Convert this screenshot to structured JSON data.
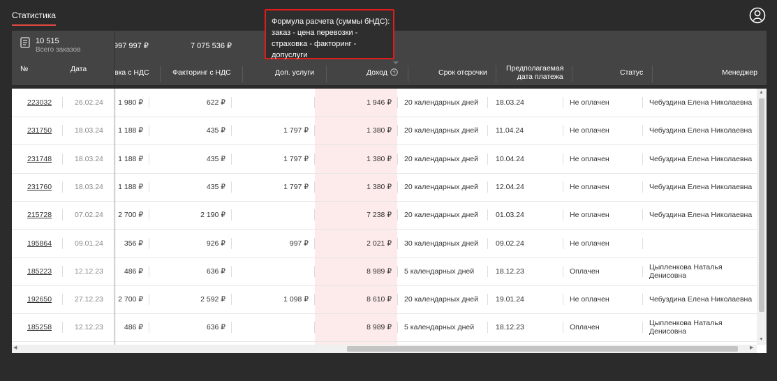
{
  "header": {
    "tab_title": "Статистика",
    "user_icon": "user-circle-icon"
  },
  "summary": {
    "orders_count": "10 515",
    "orders_label": "Всего заказов",
    "transport_vat_total": "997 997 ₽",
    "factoring_total": "7 075 536 ₽"
  },
  "columns": {
    "number": "№",
    "date": "Дата",
    "transport_vat": "вка с НДС",
    "factoring_vat": "Факторинг с НДС",
    "extra_services": "Доп. услуги",
    "income": "Доход",
    "deferral": "Срок отсрочки",
    "expected_date_line1": "Предполагаемая",
    "expected_date_line2": "дата платежа",
    "status": "Статус",
    "manager": "Менеджер"
  },
  "tooltip": {
    "line1": "Формула расчета (суммы бНДС):",
    "line2": "заказ - цена перевозки -",
    "line3": "страховка - факторинг -",
    "line4": "допуслуги"
  },
  "rows": [
    {
      "number": "223032",
      "date": "26.02.24",
      "transport": "1 980 ₽",
      "factoring": "622 ₽",
      "extra": "",
      "income": "1 946 ₽",
      "deferral": "20 календарных дней",
      "expected": "18.03.24",
      "status": "Не оплачен",
      "manager1": "Чебуздина Елена Николаевна",
      "manager2": ""
    },
    {
      "number": "231750",
      "date": "18.03.24",
      "transport": "1 188 ₽",
      "factoring": "435 ₽",
      "extra": "1 797 ₽",
      "income": "1 380 ₽",
      "deferral": "20 календарных дней",
      "expected": "11.04.24",
      "status": "Не оплачен",
      "manager1": "Чебуздина Елена Николаевна",
      "manager2": ""
    },
    {
      "number": "231748",
      "date": "18.03.24",
      "transport": "1 188 ₽",
      "factoring": "435 ₽",
      "extra": "1 797 ₽",
      "income": "1 380 ₽",
      "deferral": "20 календарных дней",
      "expected": "10.04.24",
      "status": "Не оплачен",
      "manager1": "Чебуздина Елена Николаевна",
      "manager2": ""
    },
    {
      "number": "231760",
      "date": "18.03.24",
      "transport": "1 188 ₽",
      "factoring": "435 ₽",
      "extra": "1 797 ₽",
      "income": "1 380 ₽",
      "deferral": "20 календарных дней",
      "expected": "12.04.24",
      "status": "Не оплачен",
      "manager1": "Чебуздина Елена Николаевна",
      "manager2": ""
    },
    {
      "number": "215728",
      "date": "07.02.24",
      "transport": "2 700 ₽",
      "factoring": "2 190 ₽",
      "extra": "",
      "income": "7 238 ₽",
      "deferral": "20 календарных дней",
      "expected": "01.03.24",
      "status": "Не оплачен",
      "manager1": "Чебуздина Елена Николаевна",
      "manager2": ""
    },
    {
      "number": "195864",
      "date": "09.01.24",
      "transport": "356 ₽",
      "factoring": "926 ₽",
      "extra": "997 ₽",
      "income": "2 021 ₽",
      "deferral": "30 календарных дней",
      "expected": "09.02.24",
      "status": "Не оплачен",
      "manager1": "",
      "manager2": ""
    },
    {
      "number": "185223",
      "date": "12.12.23",
      "transport": "486 ₽",
      "factoring": "636 ₽",
      "extra": "",
      "income": "8 989 ₽",
      "deferral": "5 календарных дней",
      "expected": "18.12.23",
      "status": "Оплачен",
      "manager1": "Цыпленкова Наталья",
      "manager2": "Денисовна"
    },
    {
      "number": "192650",
      "date": "27.12.23",
      "transport": "2 700 ₽",
      "factoring": "2 592 ₽",
      "extra": "1 098 ₽",
      "income": "8 610 ₽",
      "deferral": "20 календарных дней",
      "expected": "19.01.24",
      "status": "Не оплачен",
      "manager1": "Чебуздина Елена Николаевна",
      "manager2": ""
    },
    {
      "number": "185258",
      "date": "12.12.23",
      "transport": "486 ₽",
      "factoring": "636 ₽",
      "extra": "",
      "income": "8 989 ₽",
      "deferral": "5 календарных дней",
      "expected": "18.12.23",
      "status": "Оплачен",
      "manager1": "Цыпленкова Наталья",
      "manager2": "Денисовна"
    }
  ],
  "colors": {
    "accent": "#e2483d",
    "tooltip_border": "#e21b1b",
    "income_bg": "#fdeaea"
  }
}
